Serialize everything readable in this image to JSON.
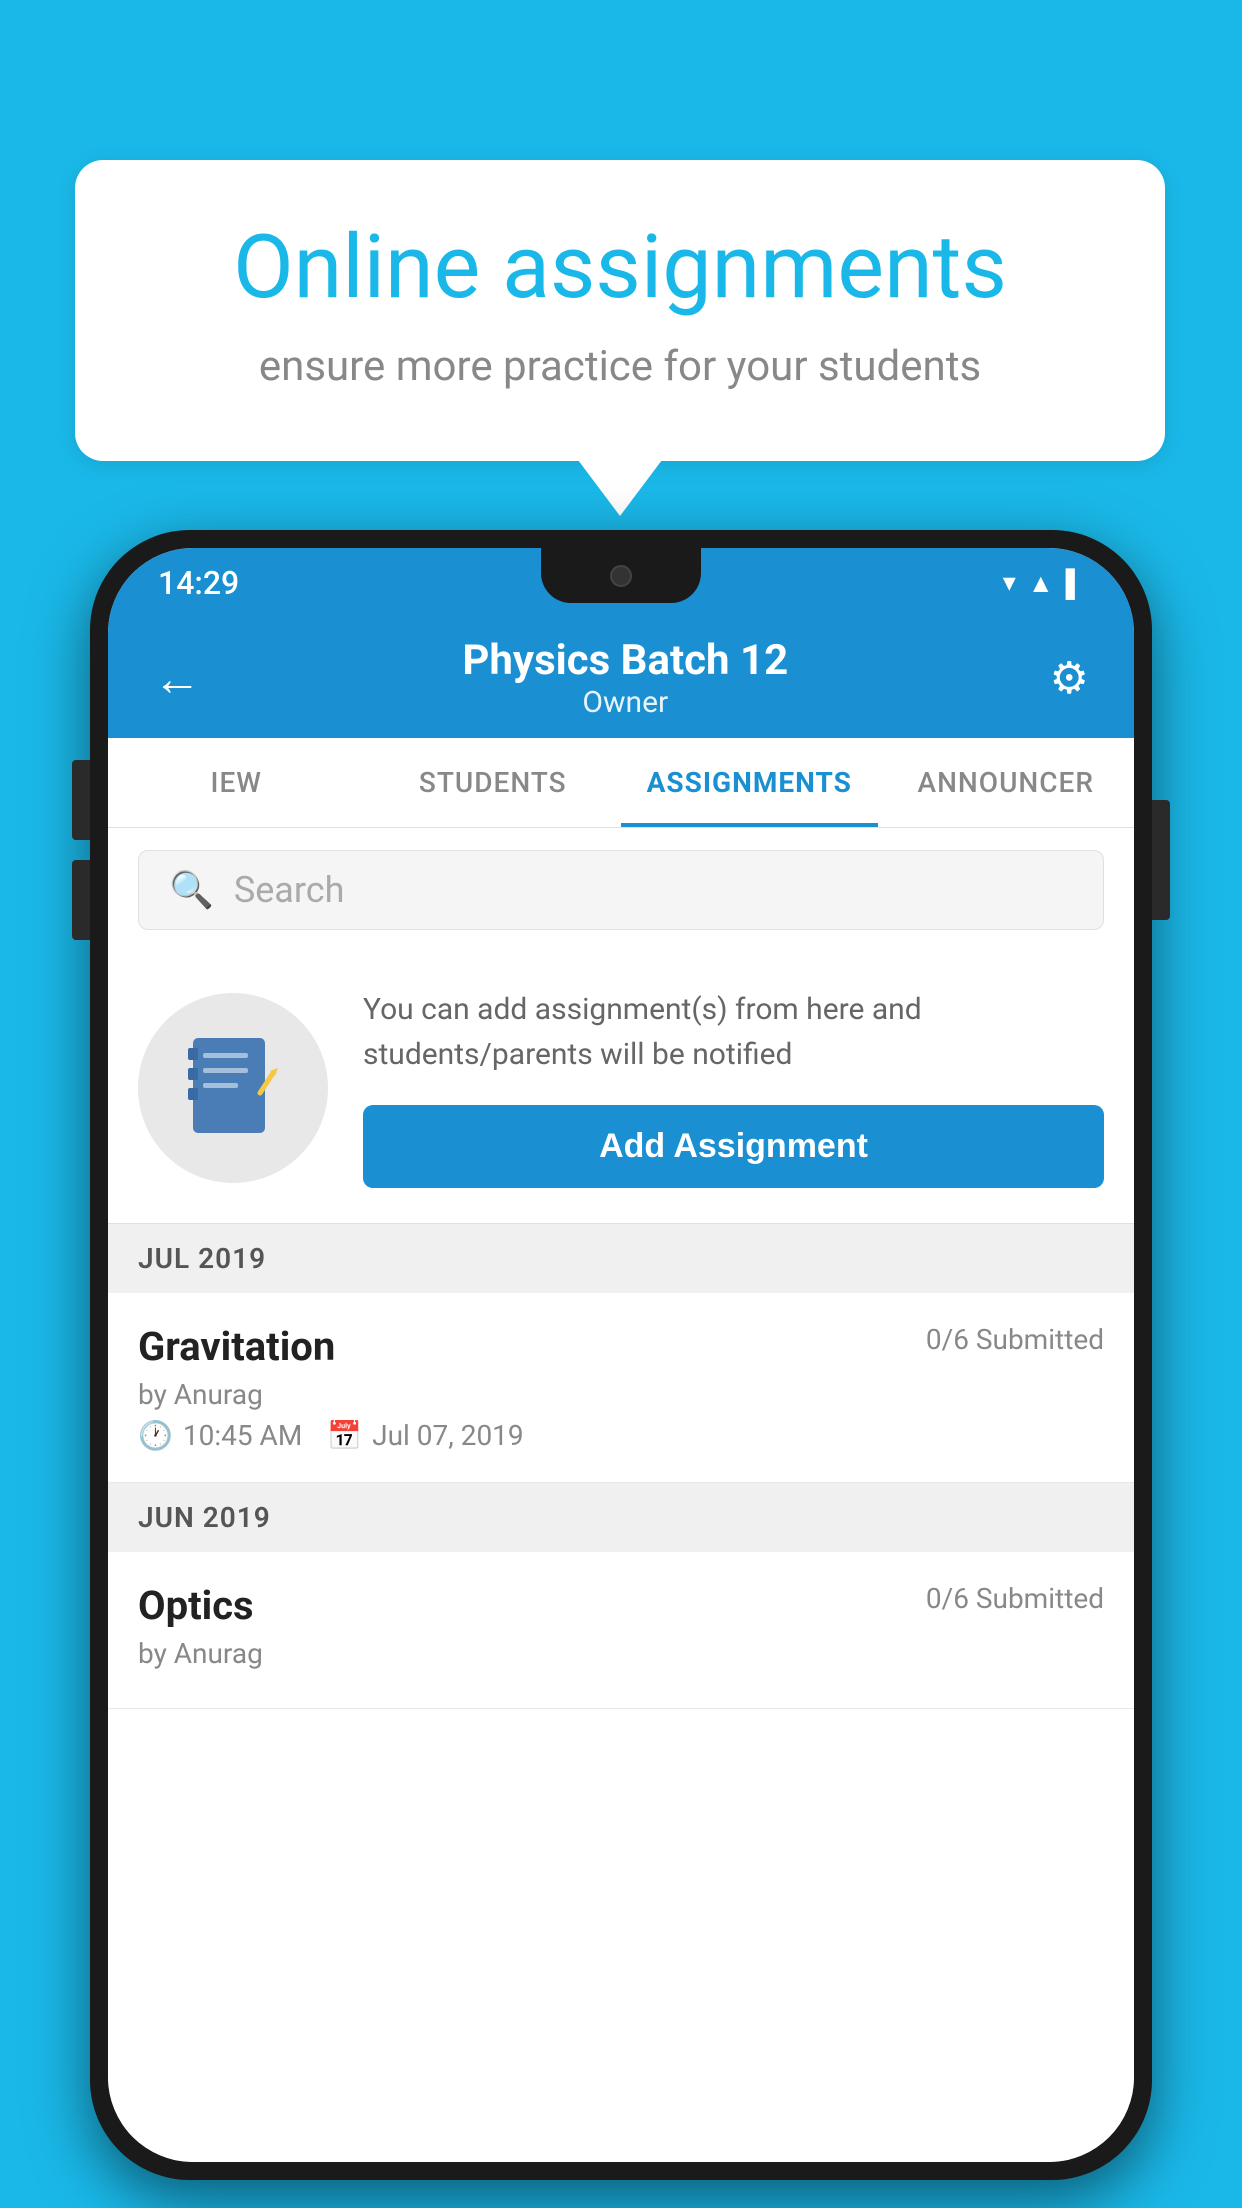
{
  "background_color": "#1ab8e8",
  "speech_bubble": {
    "title": "Online assignments",
    "subtitle": "ensure more practice for your students"
  },
  "phone": {
    "status_bar": {
      "time": "14:29",
      "wifi_icon": "▲",
      "signal_icon": "▲",
      "battery_icon": "▌"
    },
    "header": {
      "title": "Physics Batch 12",
      "subtitle": "Owner",
      "back_label": "←",
      "settings_label": "⚙"
    },
    "tabs": [
      {
        "label": "IEW",
        "active": false
      },
      {
        "label": "STUDENTS",
        "active": false
      },
      {
        "label": "ASSIGNMENTS",
        "active": true
      },
      {
        "label": "ANNOUNCER",
        "active": false
      }
    ],
    "search": {
      "placeholder": "Search"
    },
    "promo": {
      "description": "You can add assignment(s) from here and students/parents will be notified",
      "add_button_label": "Add Assignment"
    },
    "sections": [
      {
        "month": "JUL 2019",
        "assignments": [
          {
            "name": "Gravitation",
            "submitted": "0/6 Submitted",
            "by": "by Anurag",
            "time": "10:45 AM",
            "date": "Jul 07, 2019"
          }
        ]
      },
      {
        "month": "JUN 2019",
        "assignments": [
          {
            "name": "Optics",
            "submitted": "0/6 Submitted",
            "by": "by Anurag",
            "time": "",
            "date": ""
          }
        ]
      }
    ]
  }
}
